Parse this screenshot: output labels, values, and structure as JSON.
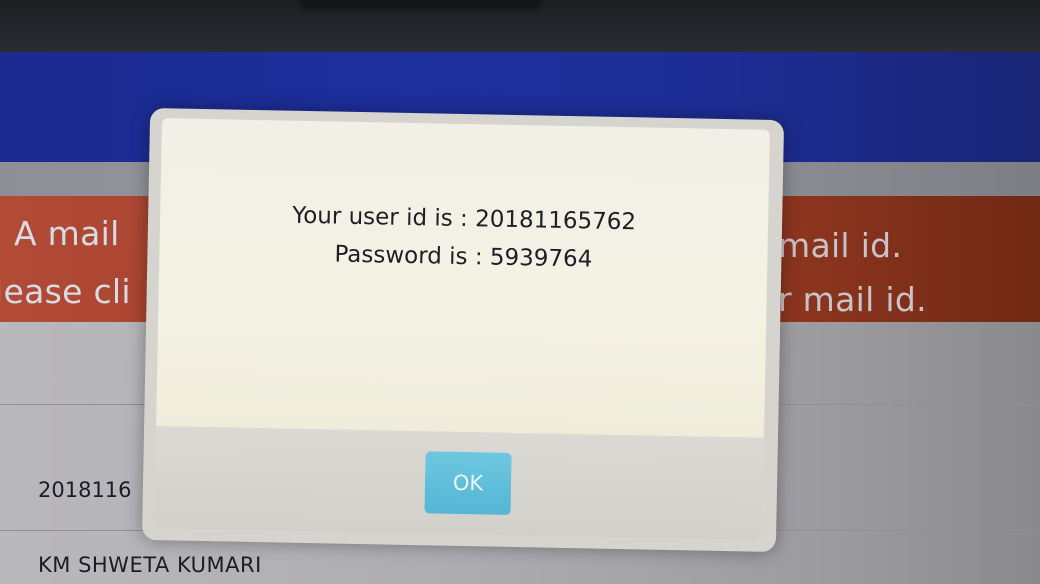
{
  "background": {
    "alert_line1_left": "A mail",
    "alert_line2_left": "lease cli",
    "alert_line1_right": "mail id.",
    "alert_line2_right": "r mail id.",
    "user_id_partial": "2018116",
    "student_name": "KM SHWETA KUMARI"
  },
  "dialog": {
    "user_id_line": "Your user id is : 20181165762",
    "password_line": "Password is : 5939764",
    "ok_label": "OK"
  },
  "colors": {
    "header_blue": "#1e2f9e",
    "alert_red": "#9c3f2a",
    "ok_button": "#5bbad6"
  }
}
